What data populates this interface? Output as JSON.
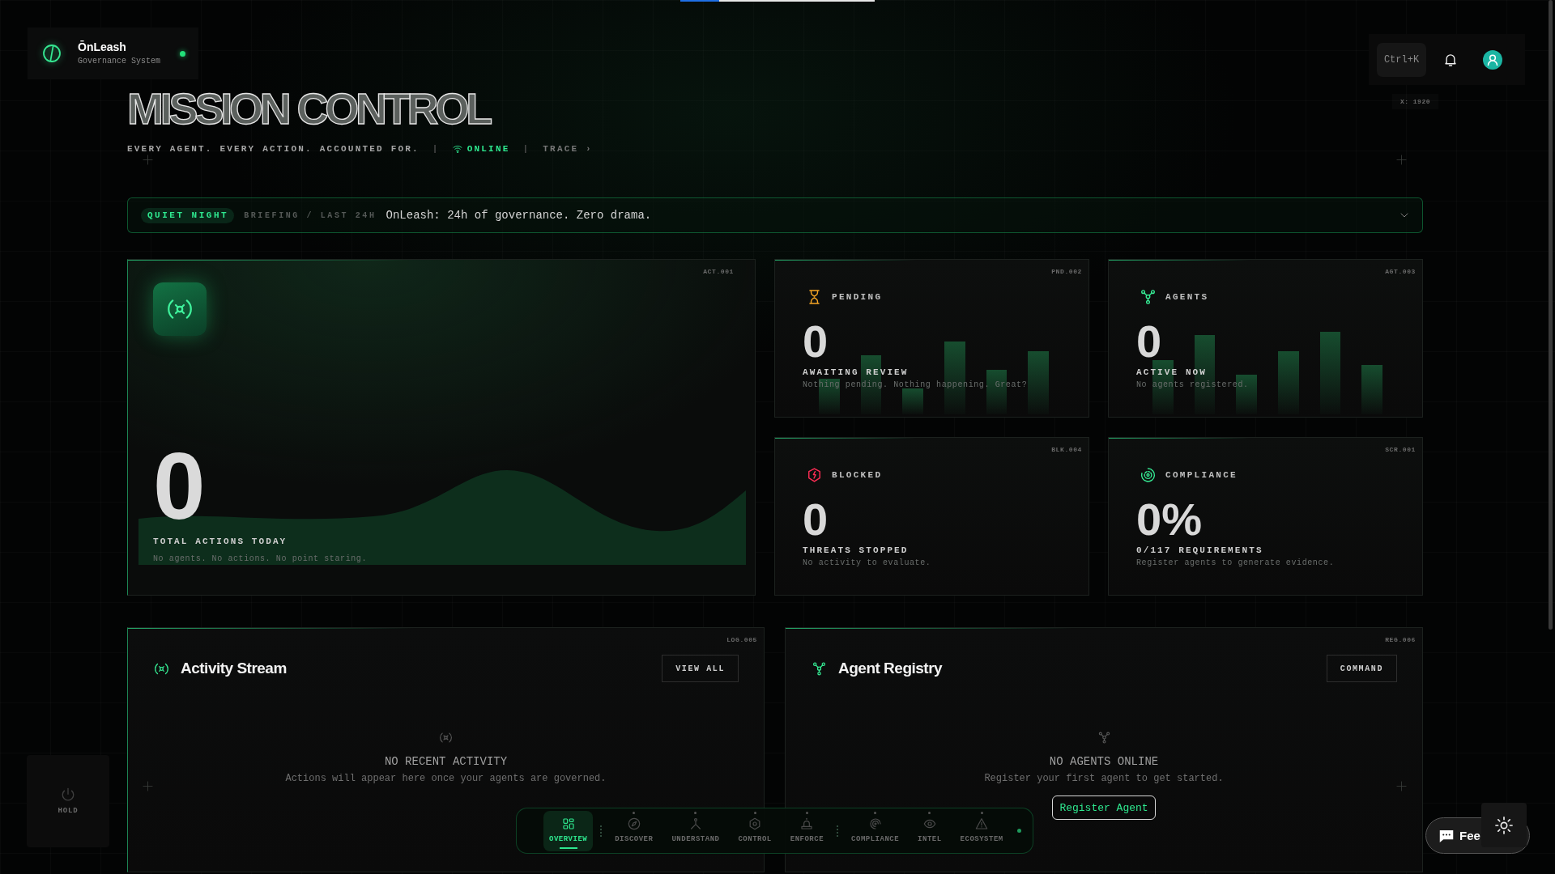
{
  "brand": {
    "name": "ŌnLeash",
    "subtitle": "Governance System",
    "online": true
  },
  "toolbar": {
    "shortcut": "Ctrl+K"
  },
  "coordinate_label": "X: 1920",
  "page": {
    "title": "MISSION CONTROL",
    "tagline": [
      {
        "kind": "text",
        "text": "EVERY AGENT. EVERY ACTION. ACCOUNTED FOR."
      },
      {
        "kind": "separator",
        "text": "|"
      },
      {
        "kind": "status",
        "text": "ONLINE"
      },
      {
        "kind": "separator",
        "text": "|"
      },
      {
        "kind": "link",
        "text": "TRACE ›"
      }
    ]
  },
  "briefing": {
    "badge": "QUIET NIGHT",
    "label": "BRIEFING / LAST 24H",
    "message": "OnLeash: 24h of governance. Zero drama.",
    "expanded": false
  },
  "hero_card": {
    "code": "ACT.001",
    "value": "0",
    "label": "TOTAL ACTIONS TODAY",
    "note": "No agents. No actions. No point staring."
  },
  "stat_cards": [
    {
      "kind": "bars",
      "code": "PND.002",
      "title": "PENDING",
      "value": "0",
      "label": "AWAITING REVIEW",
      "note": "Nothing pending. Nothing happening. Great?"
    },
    {
      "kind": "bars",
      "code": "AGT.003",
      "title": "AGENTS",
      "value": "0",
      "label": "ACTIVE NOW",
      "note": "No agents registered."
    },
    {
      "kind": "plain",
      "code": "BLK.004",
      "title": "BLOCKED",
      "value": "0",
      "label": "THREATS STOPPED",
      "note": "No activity to evaluate."
    },
    {
      "kind": "plain",
      "code": "SCR.001",
      "title": "COMPLIANCE",
      "value": "0%",
      "label": "0/117 REQUIREMENTS",
      "note": "Register agents to generate evidence."
    }
  ],
  "panels": [
    {
      "code": "LOG.005",
      "title": "Activity Stream",
      "action": "VIEW ALL",
      "empty_title": "NO RECENT ACTIVITY",
      "empty_text": "Actions will appear here once your agents are governed."
    },
    {
      "code": "REG.006",
      "title": "Agent Registry",
      "action": "COMMAND",
      "empty_title": "NO AGENTS ONLINE",
      "empty_text": "Register your first agent to get started.",
      "cta": "Register Agent"
    }
  ],
  "nav": {
    "groups": [
      {
        "items": [
          {
            "label": "OVERVIEW",
            "selected": true
          }
        ]
      },
      {
        "items": [
          {
            "label": "DISCOVER",
            "selected": false
          },
          {
            "label": "UNDERSTAND",
            "selected": false
          },
          {
            "label": "CONTROL",
            "selected": false
          },
          {
            "label": "ENFORCE",
            "selected": false
          }
        ]
      },
      {
        "items": [
          {
            "label": "COMPLIANCE",
            "selected": false
          },
          {
            "label": "INTEL",
            "selected": false
          },
          {
            "label": "ECOSYSTEM",
            "selected": false
          }
        ]
      }
    ]
  },
  "hold_button": {
    "label": "HOLD"
  },
  "feedback_button": {
    "label": "Fee"
  }
}
